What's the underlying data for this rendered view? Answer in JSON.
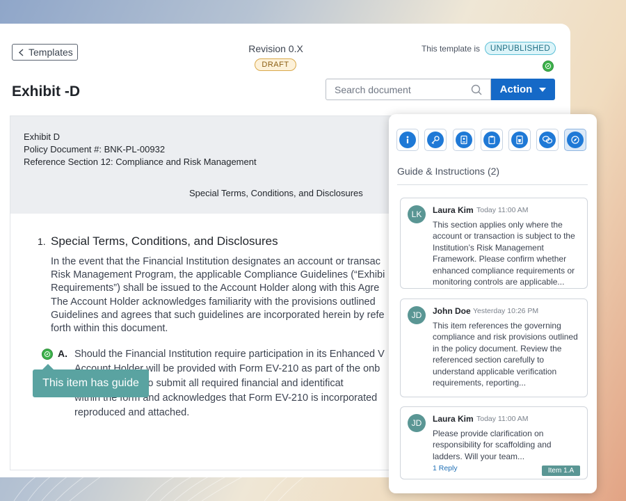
{
  "header": {
    "back_label": "Templates",
    "revision": "Revision 0.X",
    "draft_badge": "DRAFT",
    "status_label": "This template is",
    "status_badge": "UNPUBLISHED",
    "page_title": "Exhibit -D",
    "search_placeholder": "Search document",
    "action_label": "Action"
  },
  "document": {
    "header_lines": [
      "Exhibit D",
      "Policy Document #: BNK-PL-00932",
      "Reference Section 12: Compliance and Risk Management"
    ],
    "subheading": "Special Terms, Conditions, and Disclosures",
    "section_number": "1.",
    "section_title": "Special Terms, Conditions, and Disclosures",
    "section_lines": [
      "In the event that the Financial Institution designates an account or transac",
      "Risk Management Program, the applicable Compliance Guidelines (“Exhibi",
      "Requirements”) shall be issued to the Account Holder along with this Agre",
      "The Account Holder acknowledges familiarity with the provisions outlined",
      "Guidelines and agrees that such guidelines are incorporated herein by refe",
      "forth within this document."
    ],
    "item_label": "A.",
    "item_lines": [
      "Should the Financial Institution require participation in its Enhanced V",
      "Account Holder will be provided with Form EV-210 as part of the onb",
      "agrees to submit all required financial and identificat",
      "within the form and acknowledges that Form EV-210 is incorporated",
      "reproduced and attached."
    ],
    "tooltip": "This item has guide"
  },
  "guide": {
    "toolbar_icons": [
      "info-icon",
      "key-icon",
      "document-badge-icon",
      "clipboard-icon",
      "trash-doc-icon",
      "chat-bubbles-icon",
      "compass-icon"
    ],
    "active_tool": "compass-icon",
    "title": "Guide & Instructions (2)",
    "comments": [
      {
        "initials": "LK",
        "author": "Laura Kim",
        "time": "Today 11:00 AM",
        "text": "This section applies only where the account or transaction is subject to the Institution’s Risk Management Framework. Please confirm whether enhanced compliance requirements or monitoring controls are applicable..."
      },
      {
        "initials": "JD",
        "author": "John Doe",
        "time": "Yesterday 10:26 PM",
        "text": "This item references the governing compliance and risk provisions outlined in the policy document. Review the referenced section carefully to understand applicable verification requirements, reporting..."
      },
      {
        "initials": "JD",
        "author": "Laura Kim",
        "time": "Today 11:00 AM",
        "text": "Please provide clarification on responsibility for scaffolding and ladders. Will your team...",
        "reply": "1 Reply",
        "tag": "Item 1.A"
      }
    ]
  },
  "colors": {
    "primary": "#1569c7",
    "teal": "#5a9694",
    "success": "#3db24b",
    "draft": "#fdf1d9",
    "unpublished": "#dcf4f9"
  }
}
